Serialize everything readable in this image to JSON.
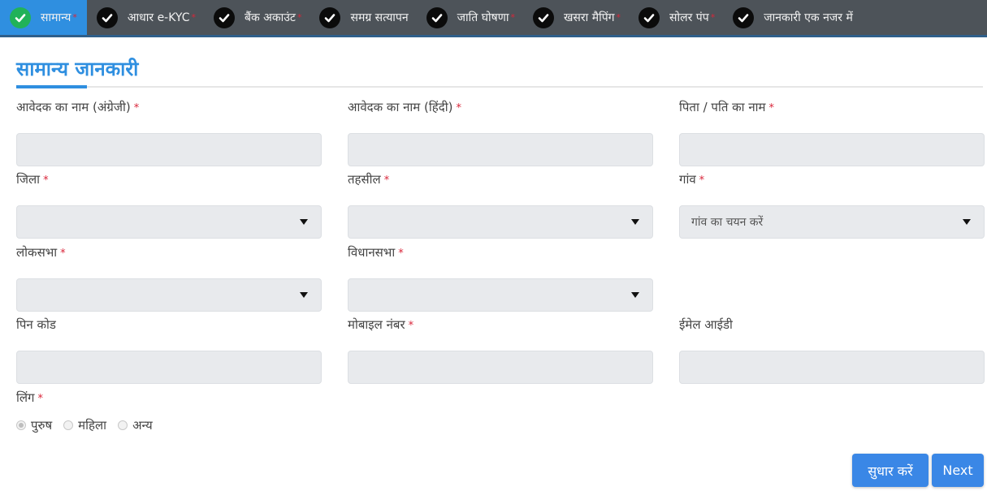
{
  "steps": [
    {
      "label": "सामान्य",
      "required": true,
      "active": true,
      "icon": "check-circle-icon"
    },
    {
      "label": "आधार e-KYC",
      "required": true,
      "active": false,
      "icon": "check-circle-icon"
    },
    {
      "label": "बैंक अकाउंट",
      "required": true,
      "active": false,
      "icon": "check-circle-icon"
    },
    {
      "label": "समग्र सत्यापन",
      "required": false,
      "active": false,
      "icon": "check-circle-icon"
    },
    {
      "label": "जाति घोषणा",
      "required": true,
      "active": false,
      "icon": "check-circle-icon"
    },
    {
      "label": "खसरा मैपिंग",
      "required": true,
      "active": false,
      "icon": "check-circle-icon"
    },
    {
      "label": "सोलर पंप",
      "required": true,
      "active": false,
      "icon": "check-circle-icon"
    },
    {
      "label": "जानकारी एक नजर में",
      "required": false,
      "active": false,
      "icon": "check-circle-icon"
    }
  ],
  "required_marker": "*",
  "section": {
    "title": "सामान्य जानकारी"
  },
  "fields": {
    "name_english": {
      "label": "आवेदक का नाम (अंग्रेजी)",
      "value": ""
    },
    "name_hindi": {
      "label": "आवेदक का नाम (हिंदी)",
      "value": ""
    },
    "father_husband_name": {
      "label": "पिता / पति का नाम",
      "value": ""
    },
    "district": {
      "label": "जिला",
      "selected": ""
    },
    "tehsil": {
      "label": "तहसील",
      "selected": ""
    },
    "village": {
      "label": "गांव",
      "selected": "गांव का चयन करें"
    },
    "loksabha": {
      "label": "लोकसभा",
      "selected": ""
    },
    "vidhansabha": {
      "label": "विधानसभा",
      "selected": ""
    },
    "pincode": {
      "label": "पिन कोड",
      "value": ""
    },
    "mobile": {
      "label": "मोबाइल नंबर",
      "value": ""
    },
    "email": {
      "label": "ईमेल आईडी",
      "value": ""
    }
  },
  "gender": {
    "label": "लिंग",
    "options": [
      {
        "label": "पुरुष",
        "checked": true
      },
      {
        "label": "महिला",
        "checked": false
      },
      {
        "label": "अन्य",
        "checked": false
      }
    ]
  },
  "buttons": {
    "edit": "सुधार करें",
    "next": "Next"
  },
  "colors": {
    "accent": "#2f8fe0",
    "stepbar": "#4d5359",
    "active_check": "#21b259",
    "required": "#d9263a",
    "button": "#3a87e6"
  }
}
